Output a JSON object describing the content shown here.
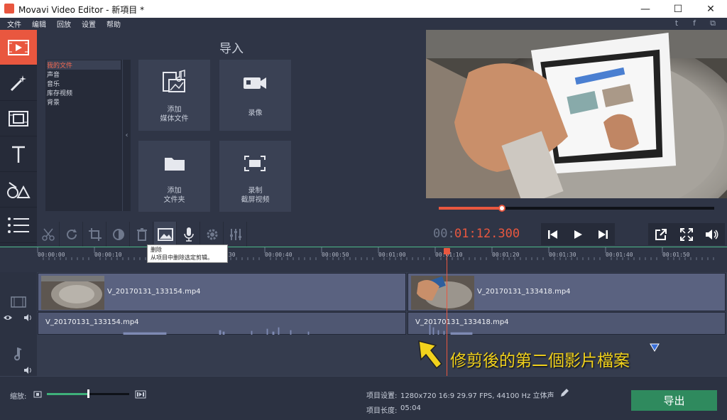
{
  "window": {
    "title": "Movavi Video Editor - 新項目 *",
    "controls": {
      "minimize": "—",
      "maximize": "☐",
      "close": "✕"
    }
  },
  "menu": [
    "文件",
    "编辑",
    "回放",
    "设置",
    "帮助"
  ],
  "social": {
    "twitter": "t",
    "facebook": "f",
    "share": "⧉"
  },
  "import_panel": {
    "title": "导入",
    "file_list": [
      "我的文件",
      "声音",
      "音乐",
      "库存视频",
      "背景"
    ],
    "collapse_glyph": "‹",
    "tiles": [
      {
        "line1": "添加",
        "line2": "媒体文件"
      },
      {
        "line1": "录像",
        "line2": ""
      },
      {
        "line1": "添加",
        "line2": "文件夹"
      },
      {
        "line1": "录制",
        "line2": "截屏视频"
      }
    ]
  },
  "tooltip": {
    "title": "删除",
    "desc": "从项目中删除选定剪辑。"
  },
  "playback": {
    "time_prefix": "00:",
    "time_value": "01:12.300",
    "progress": 0.23
  },
  "ruler": [
    "00:00:00",
    "00:00:10",
    "00:00:20",
    "00:00:30",
    "00:00:40",
    "00:00:50",
    "00:01:00",
    "00:01:10",
    "00:01:20",
    "00:01:30",
    "00:01:40",
    "00:01:50"
  ],
  "clips": {
    "video1": "V_20170131_133154.mp4",
    "video2": "V_20170131_133418.mp4",
    "audio1": "V_20170131_133154.mp4",
    "audio2": "V_20170131_133418.mp4"
  },
  "annotation": "修剪後的第二個影片檔案",
  "status": {
    "zoom_label": "缩放:",
    "project_settings_label": "项目设置:",
    "project_settings_value": "1280x720 16:9 29.97 FPS, 44100 Hz 立体声",
    "project_length_label": "项目长度:",
    "project_length_value": "05:04",
    "export_label": "导出",
    "zoom_level": 0.5
  },
  "colors": {
    "accent": "#e9573f",
    "export": "#2f8a5e",
    "annotation": "#f2d21c",
    "timecode": "#e9573f"
  }
}
